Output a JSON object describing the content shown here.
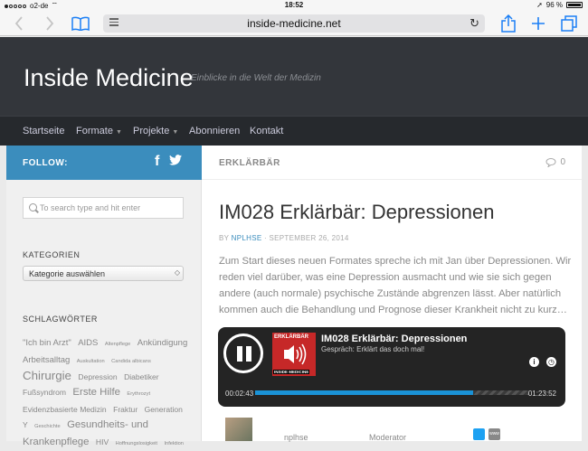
{
  "status": {
    "carrier": "o2-de",
    "time": "18:52",
    "battery": "96 %"
  },
  "browser": {
    "url": "inside-medicine.net"
  },
  "site": {
    "title": "Inside Medicine",
    "description": "Einblicke in die Welt der Medizin",
    "nav": [
      {
        "label": "Startseite"
      },
      {
        "label": "Formate",
        "dropdown": true
      },
      {
        "label": "Projekte",
        "dropdown": true
      },
      {
        "label": "Abonnieren"
      },
      {
        "label": "Kontakt"
      }
    ]
  },
  "sidebar": {
    "follow_label": "FOLLOW:",
    "search_placeholder": "To search type and hit enter",
    "categories_heading": "KATEGORIEN",
    "categories_select": "Kategorie auswählen",
    "tags_heading": "SCHLAGWÖRTER",
    "tags": [
      {
        "text": "\"Ich bin Arzt\"",
        "size": 10
      },
      {
        "text": "AIDS",
        "size": 10
      },
      {
        "text": "Altenpflege",
        "size": 6
      },
      {
        "text": "Ankündigung",
        "size": 10
      },
      {
        "text": "Arbeitsalltag",
        "size": 10
      },
      {
        "text": "Auskultation",
        "size": 6
      },
      {
        "text": "Candida albicans",
        "size": 6
      },
      {
        "text": "Chirurgie",
        "size": 14
      },
      {
        "text": "Depression",
        "size": 9
      },
      {
        "text": "Diabetiker",
        "size": 9
      },
      {
        "text": "Fußsyndrom",
        "size": 9
      },
      {
        "text": "Erste Hilfe",
        "size": 12
      },
      {
        "text": "Erythrozyt",
        "size": 6
      },
      {
        "text": "Evidenzbasierte Medizin",
        "size": 9
      },
      {
        "text": "Fraktur",
        "size": 9
      },
      {
        "text": "Generation Y",
        "size": 9
      },
      {
        "text": "Geschichte",
        "size": 6
      },
      {
        "text": "Gesundheits- und Krankenpflege",
        "size": 12
      },
      {
        "text": "HIV",
        "size": 9
      },
      {
        "text": "Hoffnungslosigkeit",
        "size": 6
      },
      {
        "text": "Infektion",
        "size": 6
      }
    ]
  },
  "post": {
    "category": "ERKLÄRBÄR",
    "comments": "0",
    "title": "IM028 Erklärbär: Depressionen",
    "by": "BY",
    "author": "NPLHSE",
    "date": "· SEPTEMBER 26, 2014",
    "excerpt": "Zum Start dieses neuen Formates spreche ich mit Jan über Depressionen. Wir reden viel darüber, was eine Depression ausmacht und wie sie sich gegen andere (auch normale) psychische Zustände abgrenzen lässt. Aber natürlich kommen auch die Behandlung und Prognose dieser Krankheit nicht zu kurz…"
  },
  "player": {
    "title": "IM028 Erklärbär: Depressionen",
    "subtitle": "Gespräch: Erklärt das doch mal!",
    "cover_top": "ERKLÄRBÄR",
    "cover_bottom": "INSIDE MEDICINE",
    "elapsed": "00:02:43",
    "duration": "01:23:52",
    "progress": 0.795
  },
  "contributor": {
    "name": "nplhse",
    "role": "Moderator",
    "web": "www"
  },
  "colors": {
    "accent": "#3b8dbd",
    "header_bg": "#33363b",
    "nav_bg": "#26292d",
    "player_bg": "#242424",
    "progress": "#1a92d6"
  }
}
